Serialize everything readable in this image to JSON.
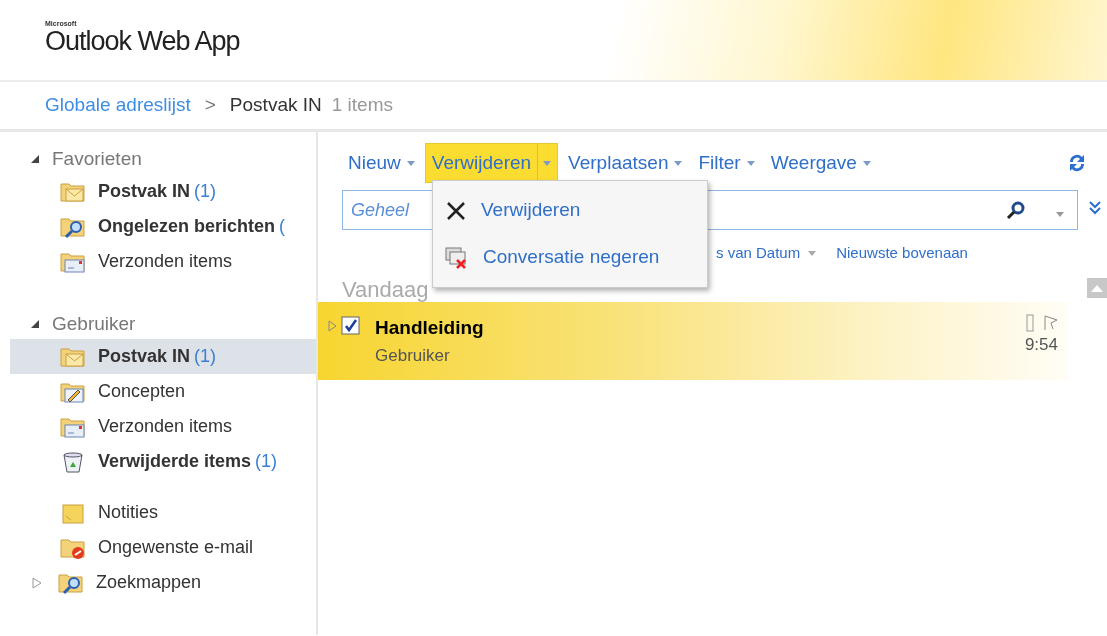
{
  "header": {
    "brand_small": "Microsoft",
    "brand": "Outlook Web App"
  },
  "breadcrumb": {
    "link": "Globale adreslijst",
    "separator": ">",
    "current": "Postvak IN",
    "count": "1 items"
  },
  "sidebar": {
    "sections": [
      {
        "title": "Favorieten",
        "expanded": true,
        "items": [
          {
            "label": "Postvak IN",
            "count": "(1)",
            "kind": "inbox",
            "unread": true,
            "selected": false,
            "expander": false
          },
          {
            "label": "Ongelezen berichten",
            "count": "(",
            "kind": "search",
            "unread": true,
            "selected": false,
            "expander": false
          },
          {
            "label": "Verzonden items",
            "kind": "sent",
            "unread": false,
            "selected": false,
            "expander": false
          }
        ]
      },
      {
        "title": "Gebruiker",
        "expanded": true,
        "items": [
          {
            "label": "Postvak IN",
            "count": "(1)",
            "kind": "inbox",
            "unread": true,
            "selected": true,
            "expander": false
          },
          {
            "label": "Concepten",
            "kind": "drafts",
            "unread": false,
            "selected": false,
            "expander": false
          },
          {
            "label": "Verzonden items",
            "kind": "sent",
            "unread": false,
            "selected": false,
            "expander": false
          },
          {
            "label": "Verwijderde items",
            "count": "(1)",
            "kind": "trash",
            "unread": true,
            "selected": false,
            "expander": false
          }
        ]
      },
      {
        "items": [
          {
            "label": "Notities",
            "kind": "notes",
            "unread": false,
            "selected": false,
            "expander": false
          },
          {
            "label": "Ongewenste e-mail",
            "kind": "junk",
            "unread": false,
            "selected": false,
            "expander": false
          },
          {
            "label": "Zoekmappen",
            "kind": "search",
            "unread": false,
            "selected": false,
            "expander": true
          }
        ]
      }
    ]
  },
  "toolbar": {
    "buttons": [
      {
        "label": "Nieuw",
        "caret": true,
        "active": false
      },
      {
        "label": "Verwijderen",
        "caret": true,
        "active": true
      },
      {
        "label": "Verplaatsen",
        "caret": true,
        "active": false
      },
      {
        "label": "Filter",
        "caret": true,
        "active": false
      },
      {
        "label": "Weergave",
        "caret": true,
        "active": false
      }
    ]
  },
  "menu": {
    "items": [
      {
        "kind": "delete",
        "label": "Verwijderen"
      },
      {
        "kind": "ignore",
        "label": "Conversatie negeren"
      }
    ]
  },
  "search": {
    "placeholder": "Geheel"
  },
  "sort": {
    "field": "s van Datum",
    "order": "Nieuwste bovenaan"
  },
  "groups": [
    {
      "title": "Vandaag",
      "messages": [
        {
          "subject": "Handleiding",
          "sender": "Gebruiker",
          "time": "9:54",
          "checked": true,
          "selected": true
        }
      ]
    }
  ]
}
